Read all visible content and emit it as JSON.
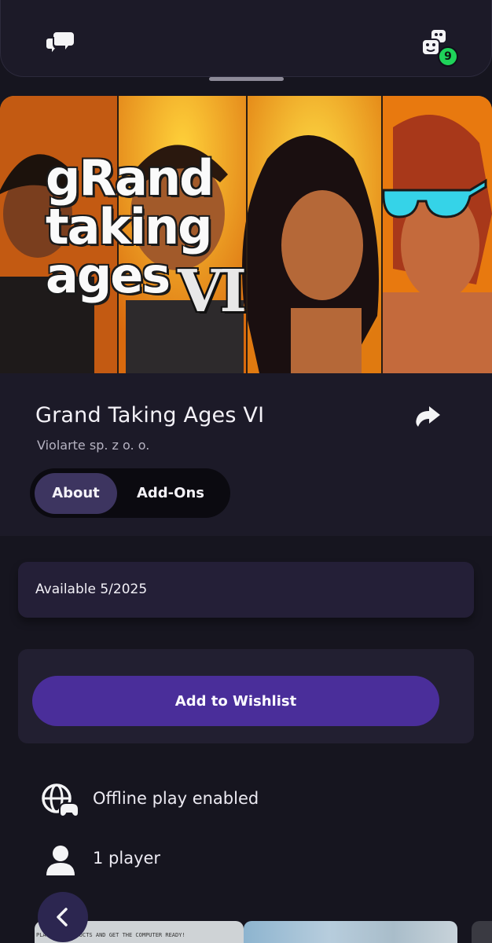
{
  "topbar": {
    "chat_icon": "chat-bubbles-icon",
    "friends_icon": "friends-dice-icon",
    "notification_count": "9"
  },
  "hero": {
    "logo_lines": [
      "gRand",
      "taking",
      "ages"
    ],
    "logo_numeral": "VI",
    "background_color": "#f3a21a"
  },
  "game": {
    "title": "Grand Taking Ages VI",
    "publisher": "Violarte sp. z o. o.",
    "share_icon": "share-arrow-icon"
  },
  "tabs": [
    {
      "label": "About",
      "active": true
    },
    {
      "label": "Add-Ons",
      "active": false
    }
  ],
  "availability": {
    "text": "Available 5/2025"
  },
  "wishlist": {
    "button_label": "Add to Wishlist",
    "accent_color": "#4a2e9a"
  },
  "features": [
    {
      "icon": "globe-controller-icon",
      "text": "Offline play enabled"
    },
    {
      "icon": "person-icon",
      "text": "1 player"
    }
  ],
  "screenshots": {
    "caption_1": "PLAY ALL PRODUCTS AND GET THE COMPUTER READY!"
  },
  "navigation": {
    "back_icon": "chevron-left-icon"
  }
}
